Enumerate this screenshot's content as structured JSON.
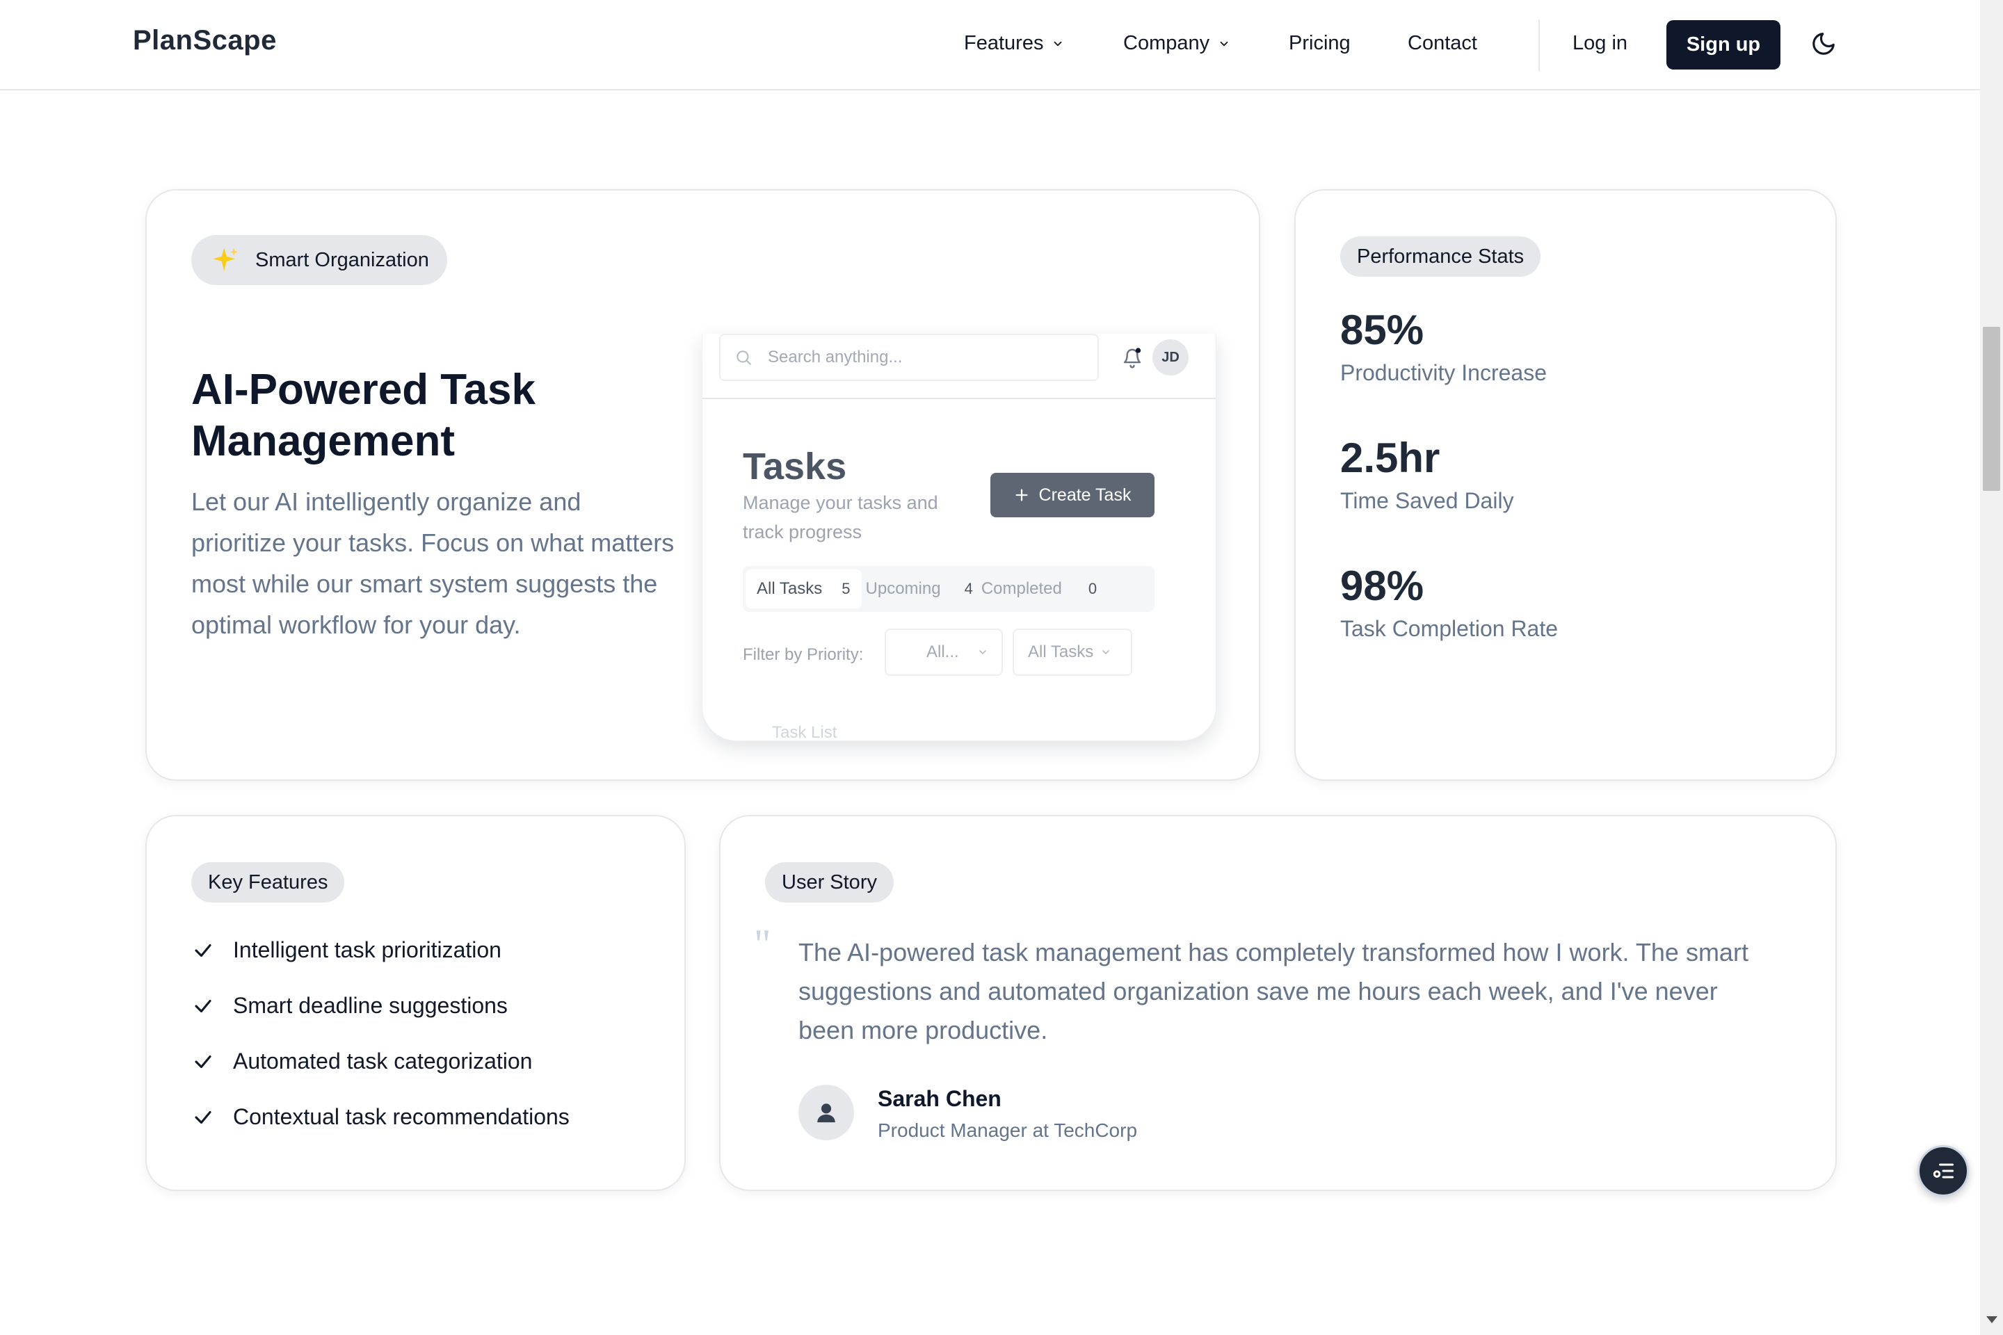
{
  "nav": {
    "brand": "PlanScape",
    "items": [
      "Features",
      "Company",
      "Pricing",
      "Contact"
    ],
    "login": "Log in",
    "signup": "Sign up"
  },
  "hero": {
    "badge": "Smart Organization",
    "title": "AI-Powered Task Management",
    "description": "Let our AI intelligently organize and prioritize your tasks. Focus on what matters most while our smart system suggests the optimal workflow for your day."
  },
  "mock_app": {
    "search_placeholder": "Search anything...",
    "avatar_initials": "JD",
    "title": "Tasks",
    "subtitle": "Manage your tasks and track progress",
    "create_button": "Create Task",
    "tabs": [
      {
        "label": "All Tasks",
        "count": "5"
      },
      {
        "label": "Upcoming",
        "count": "4"
      },
      {
        "label": "Completed",
        "count": "0"
      }
    ],
    "filter_label": "Filter by Priority:",
    "priority_select": "All...",
    "status_select": "All Tasks",
    "faded_text": "Task List"
  },
  "stats": {
    "badge": "Performance Stats",
    "items": [
      {
        "value": "85%",
        "label": "Productivity Increase"
      },
      {
        "value": "2.5hr",
        "label": "Time Saved Daily"
      },
      {
        "value": "98%",
        "label": "Task Completion Rate"
      }
    ]
  },
  "features": {
    "badge": "Key Features",
    "items": [
      "Intelligent task prioritization",
      "Smart deadline suggestions",
      "Automated task categorization",
      "Contextual task recommendations"
    ]
  },
  "story": {
    "badge": "User Story",
    "quote_mark": "\"",
    "quote": "The AI-powered task management has completely transformed how I work. The smart suggestions and automated organization save me hours each week, and I've never been more productive.",
    "name": "Sarah Chen",
    "role": "Product Manager at TechCorp"
  },
  "colors": {
    "primary": "#0f172a",
    "muted_text": "#64748b",
    "pill_bg": "#e5e7eb",
    "sparkle": "#facc15"
  },
  "icons": [
    "chevron-down-icon",
    "moon-icon",
    "sparkle-icon",
    "search-icon",
    "bell-icon",
    "plus-icon",
    "check-icon",
    "user-icon",
    "filter-list-icon"
  ]
}
